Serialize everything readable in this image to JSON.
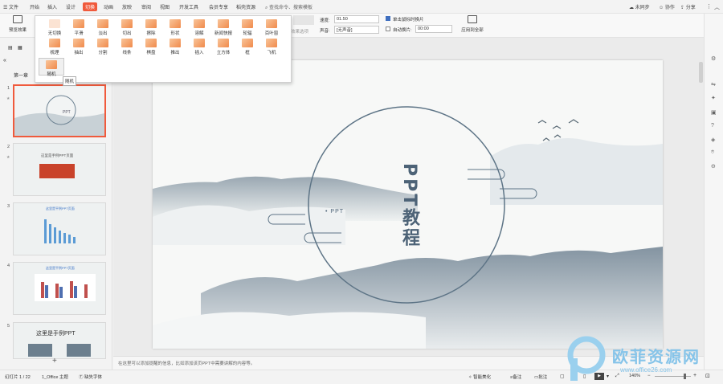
{
  "menubar": {
    "file": "文件",
    "tabs": [
      "开始",
      "插入",
      "设计",
      "切换",
      "动画",
      "放映",
      "审阅",
      "视图",
      "开发工具",
      "会员专享",
      "稻壳资源"
    ],
    "search": "查找命令、搜索模板",
    "sync": "未同步",
    "collab": "协作",
    "share": "分享"
  },
  "ribbon": {
    "preview": "预览效果",
    "effect_options": "效果选项",
    "speed_label": "速度:",
    "speed_value": "01.50",
    "sound_label": "声音:",
    "sound_value": "[无声音]",
    "on_click": "单击鼠标时换片",
    "auto_switch": "自动换片:",
    "auto_value": "00:00",
    "apply_all": "应用到全部"
  },
  "effects": [
    {
      "label": "无切换"
    },
    {
      "label": "平滑"
    },
    {
      "label": "淡出"
    },
    {
      "label": "切出"
    },
    {
      "label": "擦除"
    },
    {
      "label": "形状"
    },
    {
      "label": "溶解"
    },
    {
      "label": "新闻快报"
    },
    {
      "label": "轮辐"
    },
    {
      "label": "百叶窗"
    },
    {
      "label": "梳理"
    },
    {
      "label": "抽出"
    },
    {
      "label": "分割"
    },
    {
      "label": "线条"
    },
    {
      "label": "棋盘"
    },
    {
      "label": "推出"
    },
    {
      "label": "插入"
    },
    {
      "label": "立方体"
    },
    {
      "label": "框"
    },
    {
      "label": "飞机"
    },
    {
      "label": "随机"
    }
  ],
  "tooltip": "随机",
  "sidebar": {
    "section": "第一章",
    "slides": [
      {
        "num": "1"
      },
      {
        "num": "2",
        "title": "这里是手例PPT页面"
      },
      {
        "num": "3",
        "title": "这里是平例PPT页面"
      },
      {
        "num": "4",
        "title": "这里是平例PPT页面"
      },
      {
        "num": "5",
        "title": "这里是手例PPT"
      }
    ]
  },
  "slide": {
    "title": "PPT教程",
    "subtitle": "• PPT"
  },
  "notes": "在这里可以添加提醒的信息，比如添加该页PPT中需要讲解的内容等。",
  "status": {
    "slide_of": "幻灯片 1 / 22",
    "theme": "1_Office 主题",
    "font_missing": "缺失字体",
    "smart": "智能美化",
    "notes": "备注",
    "comment": "批注",
    "zoom": "140%"
  },
  "watermark": {
    "text": "欧菲资源网",
    "url": "www.office26.com"
  },
  "colors": {
    "accent": "#f05a3c",
    "ink": "#5a6f80"
  }
}
